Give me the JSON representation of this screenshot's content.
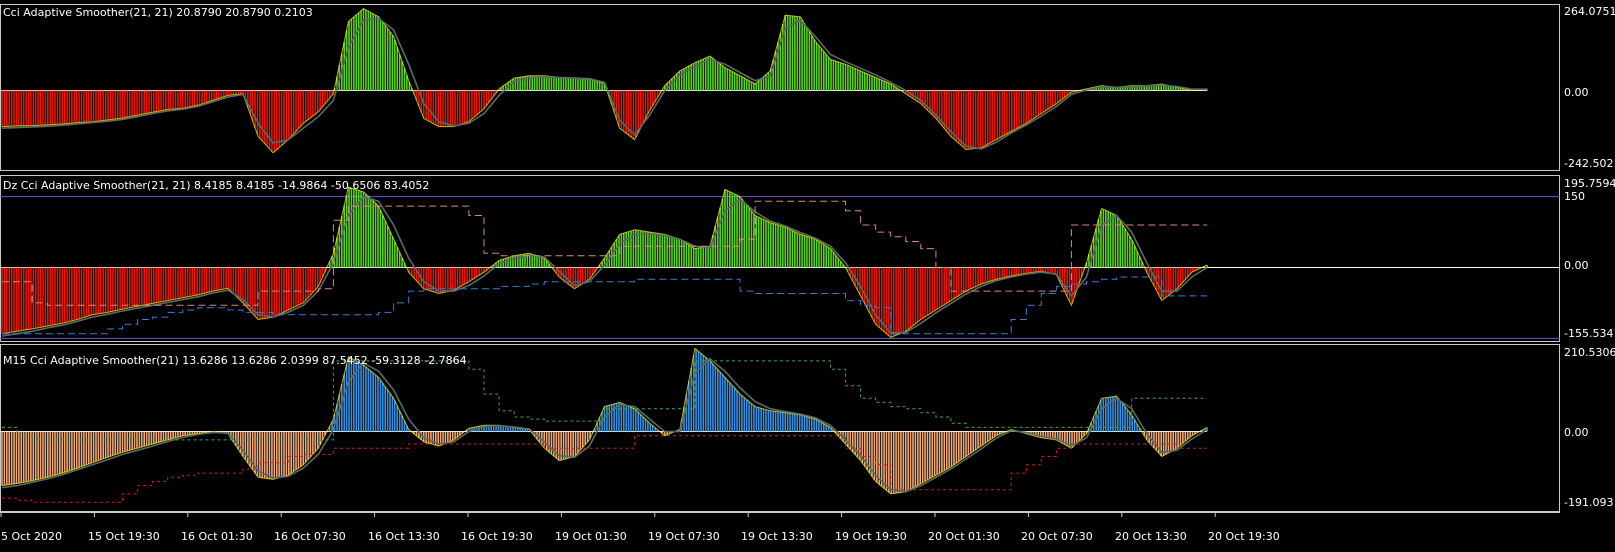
{
  "colors": {
    "background": "#000000",
    "frame": "#c8c8c8",
    "zero_line": "#ffffff",
    "level_line": "#6a5acd",
    "pane1_up": "#5bd12a",
    "pane1_down": "#e01a0c",
    "pane2_up": "#5bd12a",
    "pane2_down": "#e01a0c",
    "pane3_up": "#3a8fe0",
    "pane3_down": "#f0a878",
    "edge": "#ffff00",
    "signal": "#5a6a6a",
    "band_upper": "#d48a8a",
    "band_lower": "#3a7ad8",
    "pane3_band_upper": "#3ea83e",
    "pane3_band_lower": "#d02020"
  },
  "x_axis": {
    "labels": [
      "5 Oct 2020",
      "15 Oct 19:30",
      "16 Oct 01:30",
      "16 Oct 07:30",
      "16 Oct 13:30",
      "16 Oct 19:30",
      "19 Oct 01:30",
      "19 Oct 07:30",
      "19 Oct 13:30",
      "19 Oct 19:30",
      "20 Oct 01:30",
      "20 Oct 07:30",
      "20 Oct 13:30",
      "20 Oct 19:30"
    ]
  },
  "chart_data": [
    {
      "type": "histogram",
      "title": "Cci Adaptive Smoother(21, 21) 20.8790 20.8790 0.2103",
      "ylim": [
        -242.5021,
        264.0751
      ],
      "y_ticks": [
        "264.0751",
        "0.00",
        "-242.5021"
      ],
      "x": [
        0,
        15,
        30,
        45,
        60,
        75,
        90,
        105,
        120,
        135,
        150,
        165,
        180,
        195,
        210,
        225,
        240,
        255,
        270,
        285,
        300,
        315,
        330,
        345,
        360,
        375,
        390,
        405,
        420,
        435,
        450,
        465,
        480,
        495,
        510,
        525,
        540,
        555,
        570,
        585,
        600,
        615,
        630,
        645,
        660,
        675,
        690,
        705,
        720,
        735,
        750,
        765,
        780,
        795,
        810,
        825,
        840,
        855,
        870,
        885,
        900,
        915,
        930,
        945,
        960,
        975,
        990,
        1005,
        1020,
        1035,
        1050,
        1065,
        1080,
        1095,
        1110,
        1125,
        1140,
        1155,
        1170,
        1185,
        1200
      ],
      "values": [
        -110,
        -108,
        -107,
        -105,
        -102,
        -98,
        -95,
        -90,
        -84,
        -75,
        -66,
        -58,
        -54,
        -45,
        -30,
        -15,
        -10,
        -140,
        -190,
        -150,
        -100,
        -65,
        -10,
        210,
        250,
        225,
        165,
        30,
        -85,
        -110,
        -110,
        -95,
        -55,
        5,
        38,
        45,
        45,
        40,
        38,
        35,
        22,
        -115,
        -150,
        -60,
        15,
        60,
        85,
        105,
        70,
        45,
        20,
        60,
        230,
        225,
        150,
        95,
        80,
        60,
        40,
        20,
        -10,
        -40,
        -85,
        -140,
        -180,
        -175,
        -150,
        -125,
        -100,
        -70,
        -40,
        -5,
        5,
        15,
        10,
        15,
        15,
        20,
        10,
        0,
        5
      ],
      "signal": [
        -115,
        -113,
        -111,
        -109,
        -106,
        -102,
        -98,
        -94,
        -88,
        -80,
        -70,
        -62,
        -57,
        -48,
        -34,
        -20,
        -12,
        -100,
        -160,
        -150,
        -115,
        -80,
        -30,
        130,
        215,
        220,
        185,
        80,
        -40,
        -95,
        -108,
        -100,
        -70,
        -15,
        28,
        40,
        42,
        40,
        38,
        36,
        25,
        -90,
        -135,
        -75,
        0,
        48,
        75,
        95,
        80,
        55,
        30,
        45,
        190,
        215,
        165,
        110,
        88,
        68,
        48,
        25,
        0,
        -30,
        -75,
        -125,
        -170,
        -178,
        -158,
        -130,
        -105,
        -78,
        -48,
        -12,
        2,
        12,
        10,
        12,
        14,
        17,
        12,
        4,
        4
      ]
    },
    {
      "type": "histogram",
      "title": "Dz Cci Adaptive Smoother(21, 21) 8.4185 8.4185 -14.9864 -50.6506 83.4052",
      "ylim": [
        -155.5341,
        195.7594
      ],
      "y_ticks": [
        "195.7594",
        "150",
        "0.00",
        "-155.5341"
      ],
      "levels": [
        150,
        0,
        -150
      ],
      "x": [
        0,
        15,
        30,
        45,
        60,
        75,
        90,
        105,
        120,
        135,
        150,
        165,
        180,
        195,
        210,
        225,
        240,
        255,
        270,
        285,
        300,
        315,
        330,
        345,
        360,
        375,
        390,
        405,
        420,
        435,
        450,
        465,
        480,
        495,
        510,
        525,
        540,
        555,
        570,
        585,
        600,
        615,
        630,
        645,
        660,
        675,
        690,
        705,
        720,
        735,
        750,
        765,
        780,
        795,
        810,
        825,
        840,
        855,
        870,
        885,
        900,
        915,
        930,
        945,
        960,
        975,
        990,
        1005,
        1020,
        1035,
        1050,
        1065,
        1080,
        1095,
        1110,
        1125,
        1140,
        1155,
        1170,
        1185,
        1200
      ],
      "values": [
        -140,
        -135,
        -130,
        -124,
        -118,
        -110,
        -100,
        -95,
        -88,
        -82,
        -76,
        -70,
        -64,
        -58,
        -50,
        -44,
        -75,
        -110,
        -105,
        -90,
        -75,
        -40,
        30,
        170,
        160,
        130,
        60,
        -10,
        -45,
        -55,
        -48,
        -30,
        -10,
        15,
        25,
        30,
        20,
        -20,
        -45,
        -25,
        20,
        70,
        80,
        75,
        70,
        60,
        40,
        45,
        165,
        150,
        110,
        95,
        85,
        70,
        60,
        40,
        0,
        -60,
        -120,
        -148,
        -135,
        -110,
        -90,
        -70,
        -50,
        -35,
        -25,
        -18,
        -12,
        -8,
        -15,
        -80,
        10,
        125,
        110,
        60,
        -10,
        -70,
        -45,
        -10,
        5
      ],
      "signal": [
        -145,
        -140,
        -135,
        -128,
        -122,
        -114,
        -105,
        -99,
        -92,
        -86,
        -80,
        -74,
        -68,
        -62,
        -54,
        -48,
        -68,
        -100,
        -105,
        -95,
        -80,
        -50,
        10,
        110,
        150,
        140,
        90,
        20,
        -30,
        -50,
        -50,
        -38,
        -18,
        8,
        20,
        26,
        22,
        -8,
        -38,
        -30,
        5,
        50,
        70,
        72,
        68,
        60,
        45,
        42,
        120,
        145,
        118,
        98,
        88,
        74,
        62,
        45,
        10,
        -40,
        -100,
        -138,
        -138,
        -118,
        -96,
        -76,
        -56,
        -40,
        -28,
        -20,
        -14,
        -10,
        -14,
        -60,
        -20,
        90,
        110,
        75,
        10,
        -50,
        -50,
        -20,
        0
      ],
      "upper_band": [
        -30,
        -30,
        -75,
        -80,
        -80,
        -80,
        -80,
        -80,
        -80,
        -80,
        -80,
        -80,
        -80,
        -80,
        -80,
        -80,
        -80,
        -50,
        -50,
        -50,
        -50,
        -45,
        100,
        130,
        130,
        130,
        130,
        130,
        130,
        130,
        130,
        110,
        30,
        25,
        25,
        25,
        25,
        25,
        25,
        25,
        25,
        45,
        45,
        45,
        45,
        45,
        45,
        45,
        45,
        60,
        140,
        140,
        140,
        140,
        140,
        140,
        120,
        90,
        75,
        65,
        55,
        40,
        0,
        -50,
        -50,
        -50,
        -50,
        -50,
        -50,
        -50,
        -50,
        90,
        90,
        90,
        90,
        90,
        90,
        90,
        90,
        90,
        90
      ],
      "lower_band": [
        -140,
        -140,
        -140,
        -140,
        -140,
        -140,
        -140,
        -130,
        -120,
        -110,
        -105,
        -95,
        -90,
        -85,
        -85,
        -90,
        -95,
        -95,
        -100,
        -100,
        -100,
        -100,
        -100,
        -100,
        -100,
        -95,
        -75,
        -50,
        -45,
        -45,
        -45,
        -45,
        -45,
        -40,
        -40,
        -35,
        -30,
        -30,
        -30,
        -30,
        -30,
        -30,
        -25,
        -25,
        -25,
        -25,
        -25,
        -25,
        -25,
        -50,
        -55,
        -55,
        -55,
        -55,
        -55,
        -55,
        -70,
        -80,
        -85,
        -140,
        -140,
        -140,
        -140,
        -140,
        -140,
        -140,
        -140,
        -110,
        -80,
        -55,
        -40,
        -35,
        -30,
        -25,
        -20,
        -20,
        -20,
        -60,
        -60,
        -60,
        -60
      ]
    },
    {
      "type": "histogram",
      "title": "M15 Cci Adaptive Smoother(21) 13.6286 13.6286 2.0399 87.5452 -59.3128 -2.7864",
      "ylim": [
        -191.093,
        210.5306
      ],
      "y_ticks": [
        "210.5306",
        "0.00",
        "-191.093"
      ],
      "x": [
        0,
        15,
        30,
        45,
        60,
        75,
        90,
        105,
        120,
        135,
        150,
        165,
        180,
        195,
        210,
        225,
        240,
        255,
        270,
        285,
        300,
        315,
        330,
        345,
        360,
        375,
        390,
        405,
        420,
        435,
        450,
        465,
        480,
        495,
        510,
        525,
        540,
        555,
        570,
        585,
        600,
        615,
        630,
        645,
        660,
        675,
        690,
        705,
        720,
        735,
        750,
        765,
        780,
        795,
        810,
        825,
        840,
        855,
        870,
        885,
        900,
        915,
        930,
        945,
        960,
        975,
        990,
        1005,
        1020,
        1035,
        1050,
        1065,
        1080,
        1095,
        1110,
        1125,
        1140,
        1155,
        1170,
        1185,
        1200
      ],
      "values": [
        -130,
        -125,
        -118,
        -110,
        -100,
        -88,
        -75,
        -62,
        -50,
        -40,
        -30,
        -20,
        -10,
        -5,
        0,
        -5,
        -60,
        -110,
        -115,
        -105,
        -80,
        -40,
        30,
        180,
        160,
        130,
        80,
        5,
        -25,
        -35,
        -20,
        8,
        15,
        15,
        10,
        5,
        -40,
        -70,
        -60,
        -20,
        60,
        70,
        55,
        20,
        -10,
        5,
        200,
        170,
        130,
        90,
        60,
        50,
        45,
        40,
        30,
        10,
        -30,
        -70,
        -120,
        -150,
        -145,
        -125,
        -105,
        -85,
        -60,
        -35,
        -10,
        5,
        -5,
        -15,
        -20,
        -40,
        -5,
        80,
        85,
        40,
        -20,
        -60,
        -40,
        -10,
        10
      ],
      "signal": [
        -135,
        -130,
        -122,
        -114,
        -104,
        -92,
        -80,
        -68,
        -55,
        -45,
        -35,
        -24,
        -14,
        -7,
        -2,
        -4,
        -45,
        -95,
        -112,
        -108,
        -88,
        -55,
        5,
        120,
        165,
        145,
        100,
        30,
        -15,
        -30,
        -25,
        0,
        12,
        14,
        11,
        6,
        -25,
        -58,
        -62,
        -35,
        35,
        65,
        60,
        30,
        0,
        0,
        140,
        175,
        145,
        105,
        72,
        55,
        48,
        42,
        33,
        15,
        -20,
        -58,
        -105,
        -140,
        -145,
        -130,
        -110,
        -90,
        -66,
        -42,
        -16,
        2,
        -2,
        -12,
        -18,
        -34,
        -15,
        55,
        80,
        55,
        -5,
        -50,
        -45,
        -18,
        5
      ],
      "upper_band": [
        10,
        -10,
        -20,
        -20,
        -20,
        -20,
        -20,
        -20,
        -20,
        -20,
        -20,
        -20,
        -20,
        -20,
        -20,
        -20,
        -20,
        -20,
        -20,
        -20,
        -20,
        -20,
        170,
        170,
        170,
        170,
        170,
        170,
        170,
        170,
        170,
        150,
        90,
        50,
        35,
        30,
        25,
        25,
        25,
        25,
        55,
        55,
        55,
        55,
        55,
        55,
        170,
        170,
        170,
        170,
        170,
        170,
        170,
        170,
        170,
        150,
        110,
        80,
        70,
        60,
        55,
        45,
        35,
        20,
        10,
        10,
        10,
        10,
        10,
        10,
        10,
        10,
        10,
        10,
        10,
        80,
        80,
        80,
        80,
        80,
        80
      ],
      "lower_band": [
        -160,
        -165,
        -170,
        -170,
        -170,
        -170,
        -170,
        -170,
        -150,
        -130,
        -120,
        -110,
        -105,
        -100,
        -100,
        -100,
        -90,
        -75,
        -75,
        -60,
        -55,
        -55,
        -40,
        -40,
        -40,
        -40,
        -40,
        -30,
        -30,
        -30,
        -30,
        -30,
        -30,
        -30,
        -30,
        -30,
        -40,
        -40,
        -40,
        -40,
        -40,
        -40,
        -10,
        -10,
        -10,
        -10,
        -10,
        -10,
        -10,
        -10,
        -10,
        -10,
        -10,
        -10,
        -10,
        -10,
        -40,
        -60,
        -80,
        -140,
        -140,
        -140,
        -140,
        -140,
        -140,
        -140,
        -140,
        -100,
        -80,
        -60,
        -40,
        -30,
        -30,
        -30,
        -30,
        -30,
        -30,
        -30,
        -40,
        -40,
        -40
      ]
    }
  ]
}
